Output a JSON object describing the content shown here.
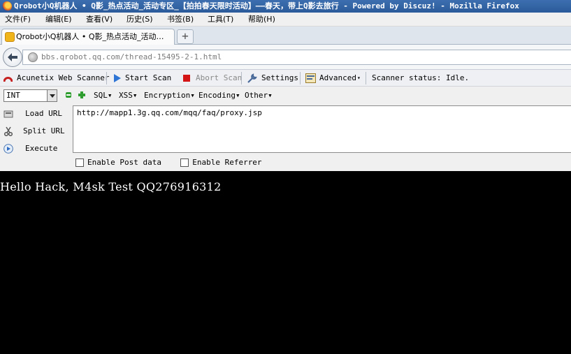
{
  "window": {
    "title": "Qrobot小Q机器人 • Q影_热点活动_活动专区_【拍拍春天限时活动】——春天，带上Q影去旅行 - Powered by Discuz! - Mozilla Firefox"
  },
  "menu": {
    "items": [
      "文件(F)",
      "编辑(E)",
      "查看(V)",
      "历史(S)",
      "书签(B)",
      "工具(T)",
      "帮助(H)"
    ]
  },
  "tabs": [
    {
      "label": "Qrobot小Q机器人 • Q影_热点活动_活动…"
    }
  ],
  "newtab_label": "+",
  "navbar": {
    "url": "bbs.qrobot.qq.com/thread-15495-2-1.html"
  },
  "acunetix": {
    "brand": "Acunetix Web Scanner",
    "start_scan": "Start Scan",
    "abort_scan": "Abort Scan",
    "settings": "Settings",
    "advanced": "Advanced",
    "status": "Scanner status: Idle."
  },
  "hackbar": {
    "type_select": "INT",
    "menus": [
      "SQL▾",
      "XSS▾",
      "Encryption▾",
      "Encoding▾",
      "Other▾"
    ],
    "load_url": "Load URL",
    "split_url": "Split URL",
    "execute": "Execute",
    "url_value": "http://mapp1.3g.qq.com/mqq/faq/proxy.jsp",
    "enable_post": "Enable Post data",
    "enable_referrer": "Enable Referrer"
  },
  "page": {
    "output_text": "Hello Hack, M4sk Test QQ276916312"
  }
}
